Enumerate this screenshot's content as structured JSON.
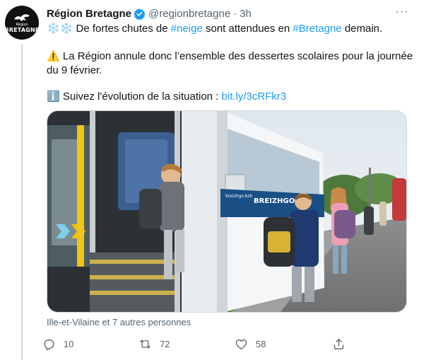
{
  "tweet": {
    "author_name": "Région Bretagne",
    "handle": "@regionbretagne",
    "separator": "·",
    "time": "3h",
    "more_label": "···",
    "avatar": {
      "text_small": "Région",
      "text_big": "BRETAGNE",
      "icon": "ermine-logo"
    },
    "line1": {
      "emoji": "❄️❄️",
      "prefix": " De fortes chutes de ",
      "hashtag1": "#neige",
      "middle": " sont attendues en ",
      "hashtag2": "#Bretagne",
      "suffix": " demain."
    },
    "line2": {
      "emoji": "⚠️",
      "text": " La Région annule donc l’ensemble des dessertes scolaires pour la journée du 9 février."
    },
    "line3": {
      "emoji": "ℹ️",
      "text": " Suivez l'évolution de la situation : ",
      "link": "bit.ly/3cRFkr3"
    },
    "photo": {
      "bus_label": "BREIZHGO",
      "bus_sublabel": "breizhgo.bzh"
    },
    "tagged_text": "Ille-et-Vilaine et 7 autres personnes",
    "actions": {
      "reply": {
        "icon": "reply-icon",
        "count": "10"
      },
      "retweet": {
        "icon": "retweet-icon",
        "count": "72"
      },
      "like": {
        "icon": "heart-icon",
        "count": "58"
      },
      "share": {
        "icon": "share-icon"
      }
    },
    "colors": {
      "accent": "#1d9bf0",
      "text": "#0f1419",
      "secondary": "#536471",
      "border": "#cfd9de"
    }
  }
}
